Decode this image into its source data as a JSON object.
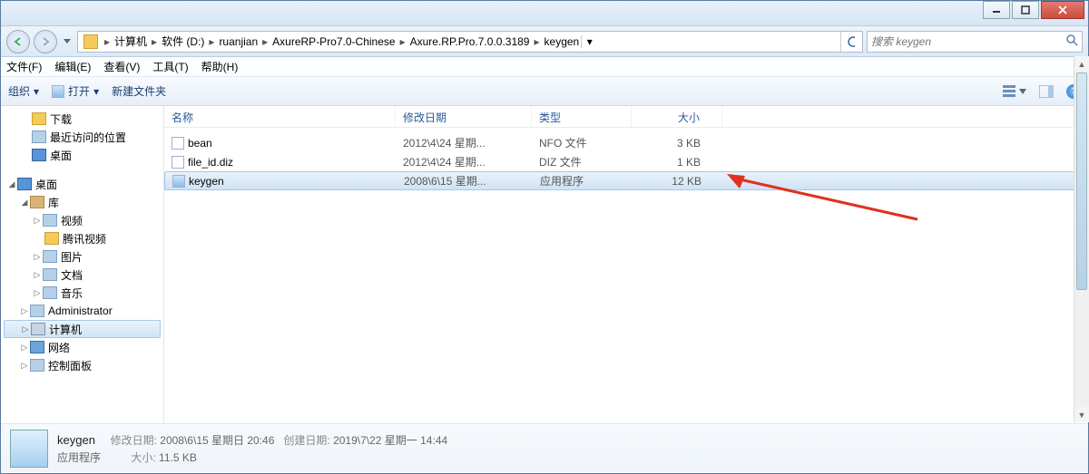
{
  "breadcrumb": {
    "items": [
      "计算机",
      "软件 (D:)",
      "ruanjian",
      "AxureRP-Pro7.0-Chinese",
      "Axure.RP.Pro.7.0.0.3189",
      "keygen"
    ]
  },
  "search": {
    "placeholder": "搜索 keygen"
  },
  "menu": {
    "file": "文件(F)",
    "edit": "编辑(E)",
    "view": "查看(V)",
    "tools": "工具(T)",
    "help": "帮助(H)"
  },
  "toolbar": {
    "organize": "组织",
    "open": "打开",
    "newfolder": "新建文件夹"
  },
  "sidebar": {
    "downloads": "下载",
    "recent": "最近访问的位置",
    "desktop1": "桌面",
    "desktop2": "桌面",
    "libraries": "库",
    "video": "视频",
    "tencent": "腾讯视频",
    "pictures": "图片",
    "documents": "文档",
    "music": "音乐",
    "admin": "Administrator",
    "computer": "计算机",
    "network": "网络",
    "control": "控制面板"
  },
  "columns": {
    "name": "名称",
    "date": "修改日期",
    "type": "类型",
    "size": "大小"
  },
  "files": [
    {
      "name": "bean",
      "date": "2012\\4\\24 星期...",
      "type": "NFO 文件",
      "size": "3 KB",
      "ico": "doc"
    },
    {
      "name": "file_id.diz",
      "date": "2012\\4\\24 星期...",
      "type": "DIZ 文件",
      "size": "1 KB",
      "ico": "doc"
    },
    {
      "name": "keygen",
      "date": "2008\\6\\15 星期...",
      "type": "应用程序",
      "size": "12 KB",
      "ico": "exe"
    }
  ],
  "details": {
    "title": "keygen",
    "line1": {
      "mod_label": "修改日期:",
      "mod_val": "2008\\6\\15 星期日 20:46",
      "cre_label": "创建日期:",
      "cre_val": "2019\\7\\22 星期一 14:44"
    },
    "line2": {
      "type": "应用程序",
      "size_label": "大小:",
      "size_val": "11.5 KB"
    }
  }
}
